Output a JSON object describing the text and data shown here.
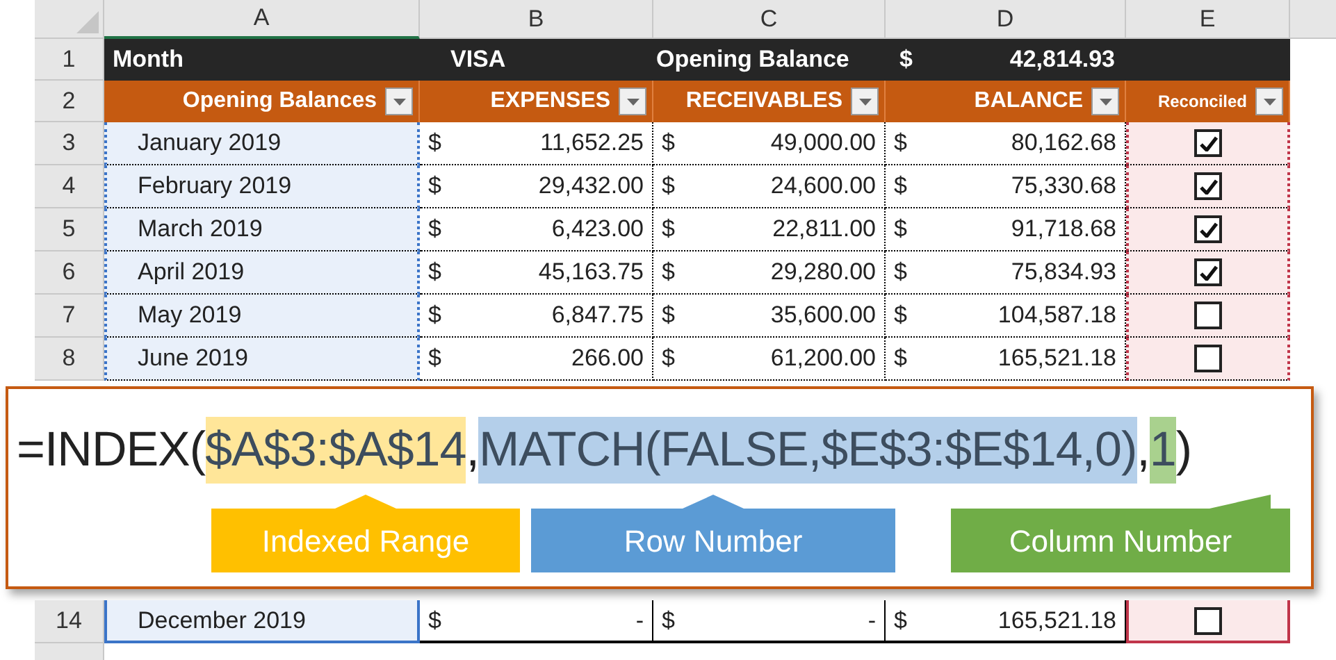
{
  "column_headers": [
    "A",
    "B",
    "C",
    "D",
    "E"
  ],
  "title_row": {
    "number": "1",
    "month_label": "Month",
    "account": "VISA",
    "opening_label": "Opening Balance",
    "currency": "$",
    "amount": "42,814.93"
  },
  "header_row": {
    "number": "2",
    "columns": [
      "Opening Balances",
      "EXPENSES",
      "RECEIVABLES",
      "BALANCE",
      "Reconciled"
    ]
  },
  "rows": [
    {
      "number": "3",
      "month": "January 2019",
      "amounts": [
        [
          "$",
          "11,652.25"
        ],
        [
          "$",
          "49,000.00"
        ],
        [
          "$",
          "80,162.68"
        ]
      ],
      "reconciled": true
    },
    {
      "number": "4",
      "month": "February 2019",
      "amounts": [
        [
          "$",
          "29,432.00"
        ],
        [
          "$",
          "24,600.00"
        ],
        [
          "$",
          "75,330.68"
        ]
      ],
      "reconciled": true
    },
    {
      "number": "5",
      "month": "March 2019",
      "amounts": [
        [
          "$",
          "6,423.00"
        ],
        [
          "$",
          "22,811.00"
        ],
        [
          "$",
          "91,718.68"
        ]
      ],
      "reconciled": true
    },
    {
      "number": "6",
      "month": "April 2019",
      "amounts": [
        [
          "$",
          "45,163.75"
        ],
        [
          "$",
          "29,280.00"
        ],
        [
          "$",
          "75,834.93"
        ]
      ],
      "reconciled": true
    },
    {
      "number": "7",
      "month": "May 2019",
      "amounts": [
        [
          "$",
          "6,847.75"
        ],
        [
          "$",
          "35,600.00"
        ],
        [
          "$",
          "104,587.18"
        ]
      ],
      "reconciled": false
    },
    {
      "number": "8",
      "month": "June 2019",
      "amounts": [
        [
          "$",
          "266.00"
        ],
        [
          "$",
          "61,200.00"
        ],
        [
          "$",
          "165,521.18"
        ]
      ],
      "reconciled": false
    }
  ],
  "formula": {
    "segments": [
      {
        "text": "=INDEX(",
        "kind": "plain"
      },
      {
        "text": "$A$3:$A$14",
        "kind": "highlight",
        "color": "#ffe699"
      },
      {
        "text": ",",
        "kind": "plain"
      },
      {
        "text": "MATCH(FALSE,$E$3:$E$14,0)",
        "kind": "highlight",
        "color": "#b4cfea"
      },
      {
        "text": ",",
        "kind": "plain"
      },
      {
        "text": "1",
        "kind": "highlight",
        "color": "#a9d18e"
      },
      {
        "text": ")",
        "kind": "plain"
      }
    ],
    "callouts": [
      {
        "label": "Indexed Range",
        "color": "#ffc000"
      },
      {
        "label": "Row Number",
        "color": "#5b9bd5"
      },
      {
        "label": "Column Number",
        "color": "#70ad47"
      }
    ]
  },
  "last_rows": [
    {
      "number": "14",
      "month": "December 2019",
      "amounts": [
        [
          "$",
          "-"
        ],
        [
          "$",
          "-"
        ],
        [
          "$",
          "165,521.18"
        ]
      ],
      "reconciled": false
    }
  ]
}
